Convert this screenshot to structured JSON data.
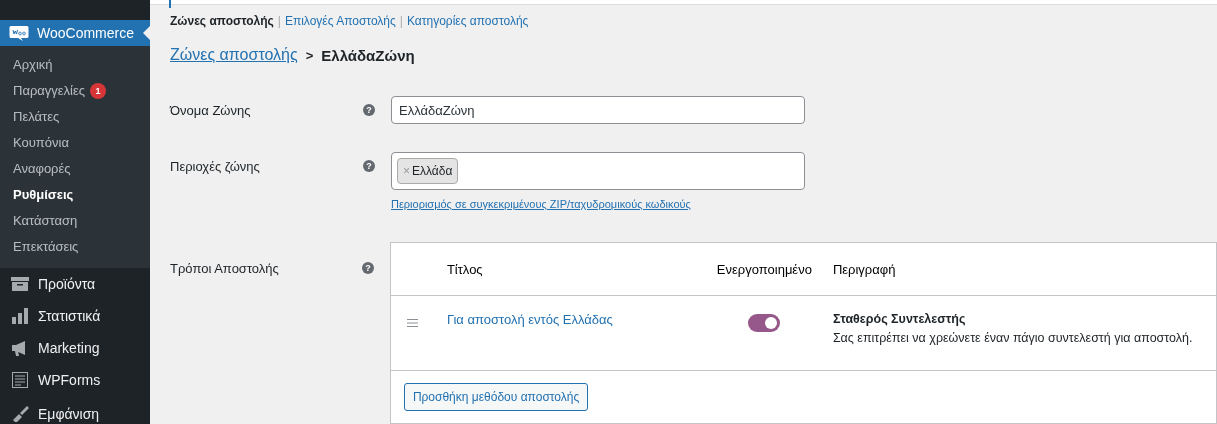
{
  "sidebar": {
    "current": {
      "label": "WooCommerce",
      "selected": true
    },
    "submenu": [
      {
        "label": "Αρχική",
        "selected": false
      },
      {
        "label": "Παραγγελίες",
        "selected": false,
        "badge": "1"
      },
      {
        "label": "Πελάτες",
        "selected": false
      },
      {
        "label": "Κουπόνια",
        "selected": false
      },
      {
        "label": "Αναφορές",
        "selected": false
      },
      {
        "label": "Ρυθμίσεις",
        "selected": true
      },
      {
        "label": "Κατάσταση",
        "selected": false
      },
      {
        "label": "Επεκτάσεις",
        "selected": false
      }
    ],
    "menu": [
      {
        "label": "Προϊόντα",
        "kind": "archive"
      },
      {
        "label": "Στατιστικά",
        "kind": "chart"
      },
      {
        "label": "Marketing",
        "kind": "megaphone"
      },
      {
        "label": "WPForms",
        "kind": "form"
      },
      {
        "label": "Εμφάνιση",
        "kind": "brush"
      }
    ]
  },
  "subnav": [
    {
      "label": "Ζώνες αποστολής",
      "selected": true
    },
    {
      "label": "Επιλογές Αποστολής",
      "selected": false
    },
    {
      "label": "Κατηγορίες αποστολής",
      "selected": false
    }
  ],
  "subnav_separator": "|",
  "help_mark": "?",
  "tag_remove": "×",
  "breadcrumb": {
    "link": "Ζώνες αποστολής",
    "separator": ">",
    "current": "ΕλλάδαΖώνη"
  },
  "fields": [
    {
      "label": "Όνομα Ζώνης",
      "kind": "text",
      "value": "ΕλλάδαΖώνη"
    },
    {
      "label": "Περιοχές ζώνης",
      "kind": "tags",
      "tags": [
        "Ελλάδα"
      ],
      "link": "Περιορισμός σε συγκεκριμένους ZIP/ταχυδρομικούς κωδικούς"
    }
  ],
  "methods": {
    "label": "Τρόποι Αποστολής",
    "columns": [
      "Τίτλος",
      "Ενεργοποιημένο",
      "Περιγραφή"
    ],
    "rows": [
      {
        "title": "Για αποστολή εντός Ελλάδας",
        "enabled": true,
        "type": "Σταθερός Συντελεστής",
        "description": "Σας επιτρέπει να χρεώνετε έναν πάγιο συντελεστή για αποστολή."
      }
    ],
    "add_button": "Προσθήκη μεθόδου αποστολής"
  }
}
